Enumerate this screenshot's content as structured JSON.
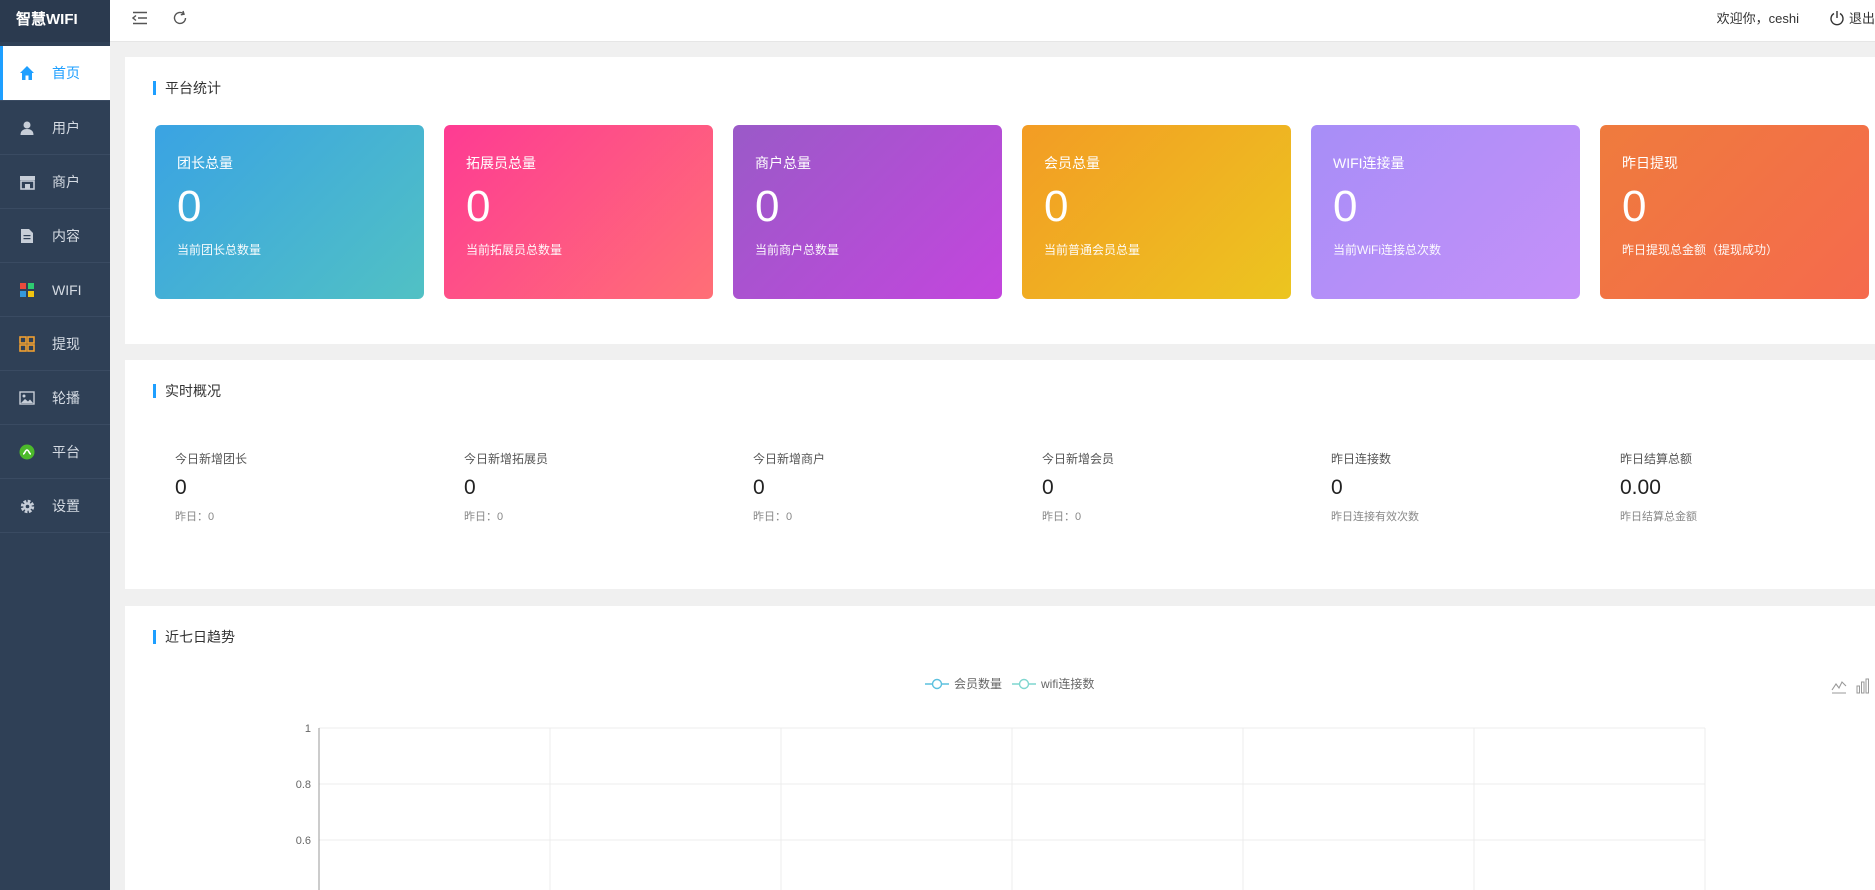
{
  "app": {
    "brand": "智慧WIFI"
  },
  "sidebar": {
    "items": [
      {
        "label": "首页",
        "icon": "home-icon",
        "active": true
      },
      {
        "label": "用户",
        "icon": "user-icon"
      },
      {
        "label": "商户",
        "icon": "store-icon"
      },
      {
        "label": "内容",
        "icon": "document-icon"
      },
      {
        "label": "WIFI",
        "icon": "wifi-grid-icon"
      },
      {
        "label": "提现",
        "icon": "withdraw-grid-icon"
      },
      {
        "label": "轮播",
        "icon": "image-icon"
      },
      {
        "label": "平台",
        "icon": "platform-icon"
      },
      {
        "label": "设置",
        "icon": "gear-icon"
      }
    ]
  },
  "header": {
    "welcome": "欢迎你，ceshi",
    "logout": "退出"
  },
  "stats": {
    "title": "平台统计",
    "cards": [
      {
        "title": "团长总量",
        "value": "0",
        "desc": "当前团长总数量",
        "gradient": [
          "#3aa3e3",
          "#51c1c4"
        ]
      },
      {
        "title": "拓展员总量",
        "value": "0",
        "desc": "当前拓展员总数量",
        "gradient": [
          "#fe3b93",
          "#ff6f76"
        ]
      },
      {
        "title": "商户总量",
        "value": "0",
        "desc": "当前商户总数量",
        "gradient": [
          "#9a5ac8",
          "#c346dd"
        ]
      },
      {
        "title": "会员总量",
        "value": "0",
        "desc": "当前普通会员总量",
        "gradient": [
          "#f39c24",
          "#ecc520"
        ]
      },
      {
        "title": "WIFI连接量",
        "value": "0",
        "desc": "当前WiFi连接总次数",
        "gradient": [
          "#a78ef7",
          "#c590f9"
        ]
      },
      {
        "title": "昨日提现",
        "value": "0",
        "desc": "昨日提现总金额（提现成功）",
        "gradient": [
          "#ef7b3d",
          "#f56a4d"
        ]
      }
    ]
  },
  "realtime": {
    "title": "实时概况",
    "items": [
      {
        "label": "今日新增团长",
        "value": "0",
        "sub": "昨日：0"
      },
      {
        "label": "今日新增拓展员",
        "value": "0",
        "sub": "昨日：0"
      },
      {
        "label": "今日新增商户",
        "value": "0",
        "sub": "昨日：0"
      },
      {
        "label": "今日新增会员",
        "value": "0",
        "sub": "昨日：0"
      },
      {
        "label": "昨日连接数",
        "value": "0",
        "sub": "昨日连接有效次数"
      },
      {
        "label": "昨日结算总额",
        "value": "0.00",
        "sub": "昨日结算总金额"
      }
    ]
  },
  "trend": {
    "title": "近七日趋势",
    "tools": [
      "line-chart-icon",
      "bar-chart-icon"
    ]
  },
  "chart_data": {
    "type": "line",
    "series": [
      {
        "name": "会员数量",
        "color": "#5bc0de",
        "values": []
      },
      {
        "name": "wifi连接数",
        "color": "#7fd6cf",
        "values": []
      }
    ],
    "y_ticks": [
      "1",
      "0.8",
      "0.6"
    ],
    "grid": true,
    "legend": "top-center"
  }
}
